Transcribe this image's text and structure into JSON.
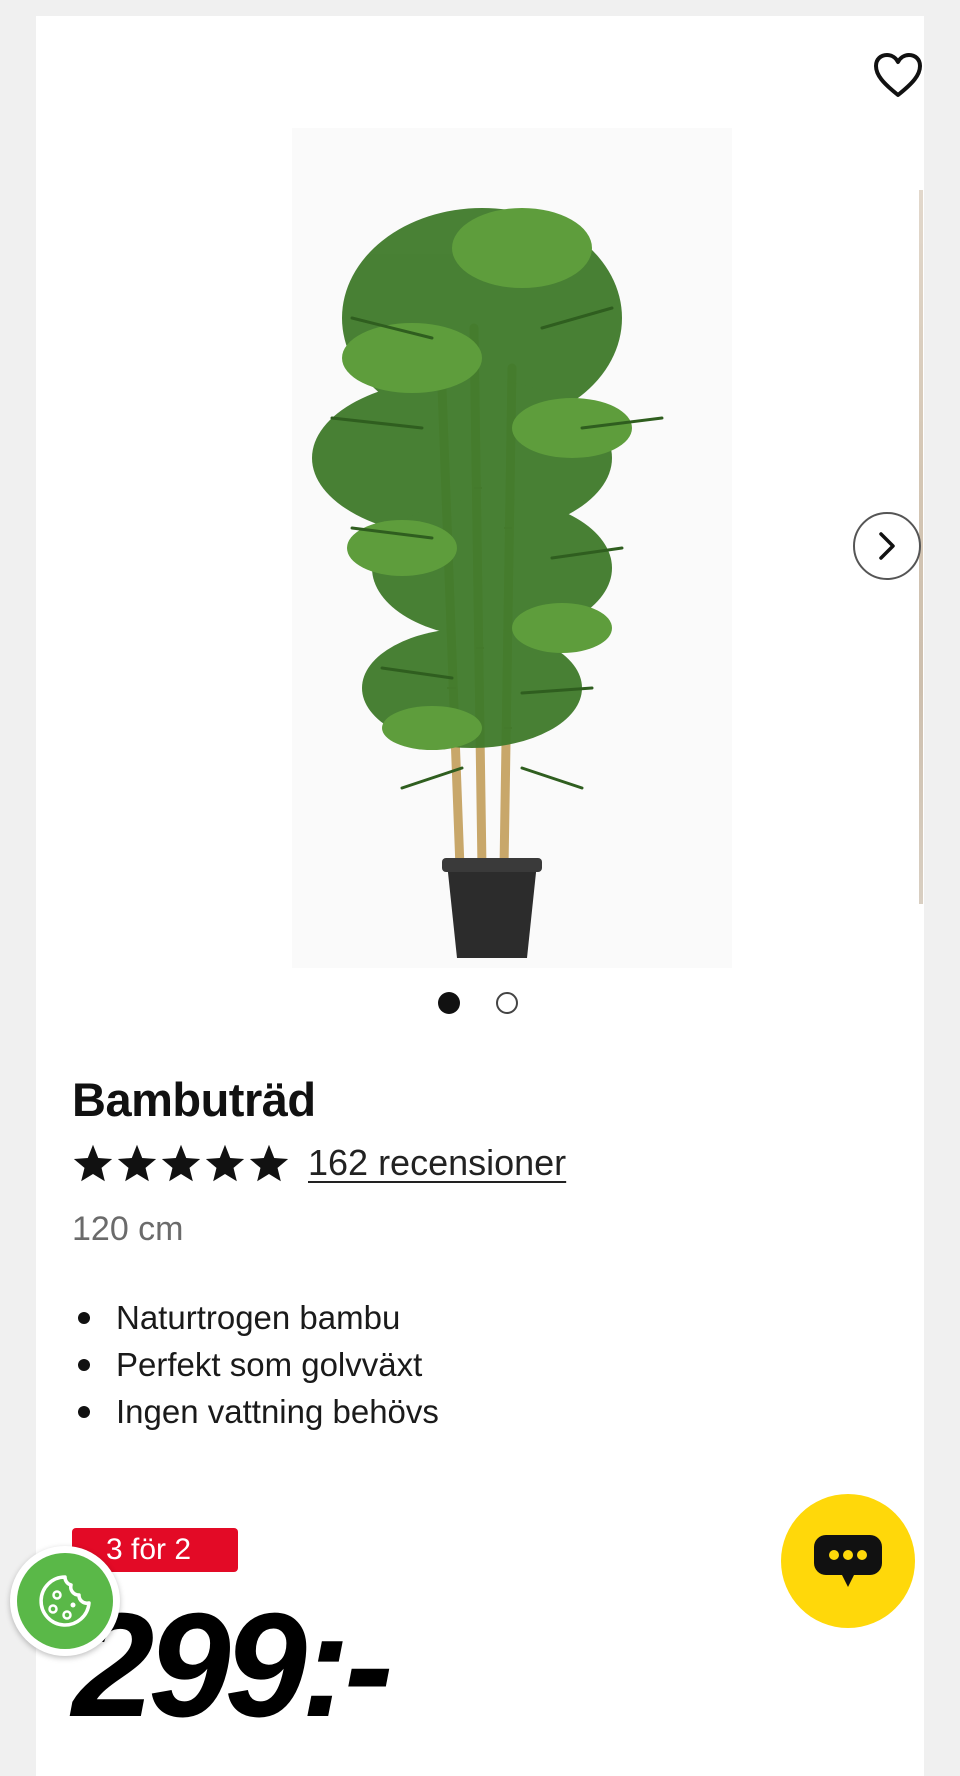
{
  "product": {
    "title": "Bambuträd",
    "rating": {
      "stars": 5,
      "max_stars": 5,
      "reviews_label": "162 recensioner"
    },
    "variant": "120 cm",
    "features": [
      "Naturtrogen bambu",
      "Perfekt som golvväxt",
      "Ingen vattning behövs"
    ],
    "promo_badge": "3 för 2",
    "price": "299:-"
  },
  "gallery": {
    "image_count": 2,
    "active_index": 0
  },
  "icons": {
    "favorite": "heart-icon",
    "next": "chevron-right-icon",
    "cookie": "cookie-icon",
    "chat": "chat-bubble-icon"
  },
  "colors": {
    "promo_badge": "#e30a26",
    "chat_button": "#ffd80a",
    "cookie_button": "#5ab848",
    "text": "#111111",
    "variant_text": "#6b6b6b"
  }
}
